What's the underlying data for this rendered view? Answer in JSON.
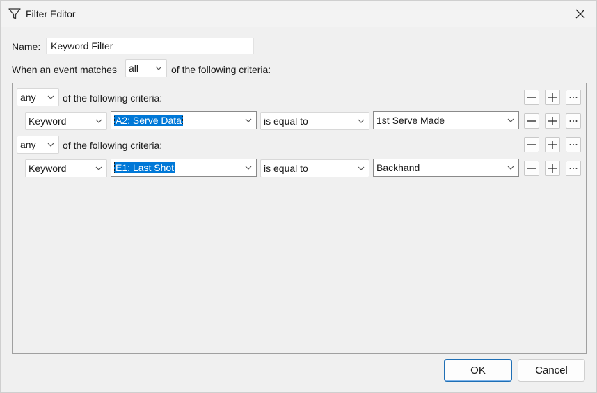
{
  "window": {
    "title": "Filter Editor",
    "icon": "filter-funnel-icon"
  },
  "name_row": {
    "label": "Name:",
    "value": "Keyword Filter"
  },
  "match_row": {
    "prefix": "When an event matches",
    "selected": "all",
    "suffix": "of the following criteria:"
  },
  "groups": [
    {
      "quantifier": "any",
      "suffix": "of the following criteria:",
      "rule": {
        "field_type": "Keyword",
        "field": "A2: Serve Data",
        "operator": "is equal to",
        "value": "1st Serve Made"
      }
    },
    {
      "quantifier": "any",
      "suffix": "of the following criteria:",
      "rule": {
        "field_type": "Keyword",
        "field": "E1: Last Shot",
        "operator": "is equal to",
        "value": "Backhand"
      }
    }
  ],
  "buttons": {
    "ok": "OK",
    "cancel": "Cancel"
  },
  "colors": {
    "selection": "#0078d7",
    "primary_border": "#1f6fb5"
  }
}
